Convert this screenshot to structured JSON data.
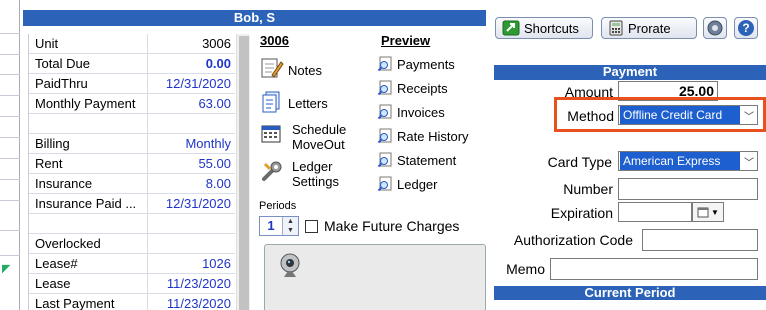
{
  "customer": {
    "name": "Bob, S"
  },
  "info_rows": [
    {
      "label": "Unit",
      "value": "3006",
      "style": "plain"
    },
    {
      "label": "Total Due",
      "value": "0.00",
      "style": "bold"
    },
    {
      "label": "PaidThru",
      "value": "12/31/2020",
      "style": ""
    },
    {
      "label": "Monthly Payment",
      "value": "63.00",
      "style": ""
    },
    {
      "label": "",
      "value": "",
      "style": ""
    },
    {
      "label": "Billing",
      "value": "Monthly",
      "style": ""
    },
    {
      "label": "Rent",
      "value": "55.00",
      "style": ""
    },
    {
      "label": "Insurance",
      "value": "8.00",
      "style": ""
    },
    {
      "label": "Insurance Paid ...",
      "value": "12/31/2020",
      "style": ""
    },
    {
      "label": "",
      "value": "",
      "style": ""
    },
    {
      "label": "Overlocked",
      "value": "",
      "style": ""
    },
    {
      "label": "Lease#",
      "value": "1026",
      "style": ""
    },
    {
      "label": "Lease",
      "value": "11/23/2020",
      "style": ""
    },
    {
      "label": "Last Payment",
      "value": "11/23/2020",
      "style": ""
    }
  ],
  "actions": {
    "unit_heading": "3006",
    "notes": "Notes",
    "letters": "Letters",
    "schedule_moveout": "Schedule\nMoveOut",
    "ledger_settings": "Ledger\nSettings"
  },
  "preview": {
    "heading": "Preview",
    "items": [
      "Payments",
      "Receipts",
      "Invoices",
      "Rate History",
      "Statement",
      "Ledger"
    ]
  },
  "periods": {
    "label": "Periods",
    "value": "1",
    "future_charges_label": "Make Future Charges"
  },
  "toolbar": {
    "shortcuts_label": "Shortcuts",
    "prorate_label": "Prorate"
  },
  "payment": {
    "header": "Payment",
    "amount_label": "Amount",
    "amount_value": "25.00",
    "method_label": "Method",
    "method_value": "Offline Credit Card",
    "card_type_label": "Card Type",
    "card_type_value": "American Express",
    "number_label": "Number",
    "expiration_label": "Expiration",
    "auth_code_label": "Authorization Code",
    "memo_label": "Memo"
  },
  "current_period": {
    "header": "Current Period"
  },
  "colors": {
    "accent": "#2c63b8",
    "link_value": "#1f35c8",
    "highlight": "#e8501d",
    "selection": "#1e5fd0"
  }
}
